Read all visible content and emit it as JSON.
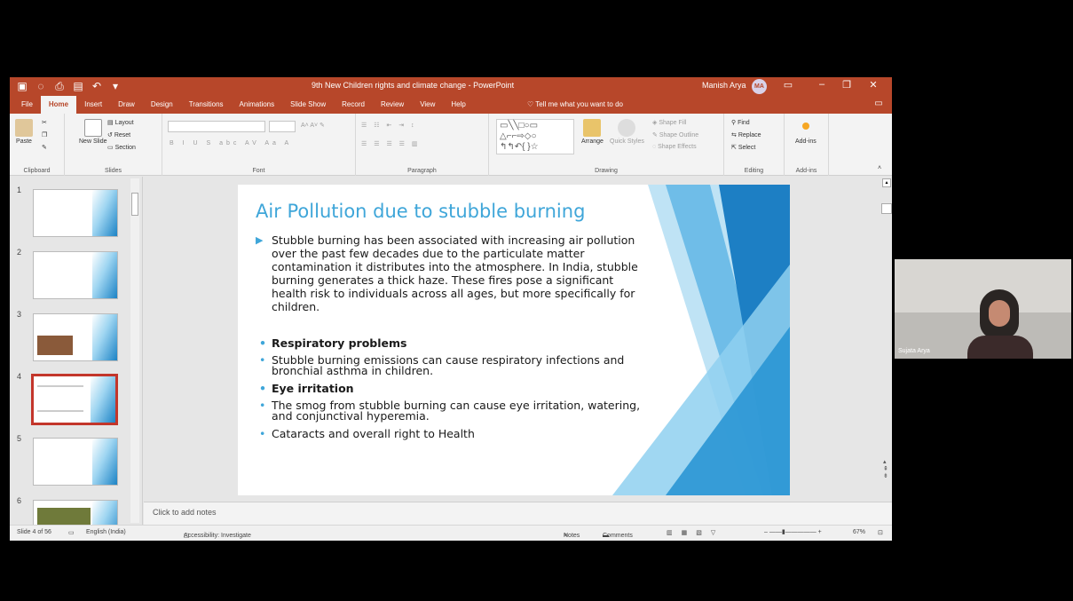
{
  "titlebar": {
    "document_title": "9th New Children rights and climate change - PowerPoint",
    "user_name": "Manish Arya",
    "user_initials": "MA",
    "qat_icons": [
      "save-icon",
      "autosave-icon",
      "print-preview-icon",
      "open-icon",
      "undo-icon",
      "customize-qat-icon"
    ]
  },
  "tabs": [
    "File",
    "Home",
    "Insert",
    "Draw",
    "Design",
    "Transitions",
    "Animations",
    "Slide Show",
    "Record",
    "Review",
    "View",
    "Help"
  ],
  "active_tab": "Home",
  "tell_me": "Tell me what you want to do",
  "ribbon": {
    "clipboard": {
      "paste": "Paste",
      "label": "Clipboard"
    },
    "slides": {
      "new_slide": "New Slide",
      "layout": "Layout",
      "reset": "Reset",
      "section": "Section",
      "label": "Slides"
    },
    "font": {
      "label": "Font"
    },
    "paragraph": {
      "label": "Paragraph"
    },
    "drawing": {
      "arrange": "Arrange",
      "quick_styles": "Quick Styles",
      "shape_fill": "Shape Fill",
      "shape_outline": "Shape Outline",
      "shape_effects": "Shape Effects",
      "label": "Drawing"
    },
    "editing": {
      "find": "Find",
      "replace": "Replace",
      "select": "Select",
      "label": "Editing"
    },
    "addins": {
      "button": "Add-ins",
      "label": "Add-ins"
    }
  },
  "thumbnails": [
    "1",
    "2",
    "3",
    "4",
    "5",
    "6"
  ],
  "selected_slide": "4",
  "slide": {
    "title": "Air Pollution due to stubble burning",
    "lead": "Stubble burning has been associated with increasing air pollution over the past few decades due to the particulate matter contamination it distributes into the atmosphere. In India, stubble burning generates a thick haze. These fires pose a significant health risk to individuals across all ages, but more specifically for children.",
    "bullets": [
      {
        "text": "Respiratory problems",
        "bold": true
      },
      {
        "text": "Stubble burning emissions can cause respiratory infections and bronchial asthma in children.",
        "bold": false
      },
      {
        "text": "Eye irritation",
        "bold": true
      },
      {
        "text": "The smog from stubble burning can cause eye irritation, watering, and conjunctival hyperemia.",
        "bold": false
      },
      {
        "text": "Cataracts and overall right to Health",
        "bold": false
      }
    ]
  },
  "notes_placeholder": "Click to add notes",
  "statusbar": {
    "slide_count": "Slide 4 of 56",
    "language": "English (India)",
    "accessibility": "Accessibility: Investigate",
    "notes": "Notes",
    "comments": "Comments",
    "zoom": "67%"
  },
  "video": {
    "participant": "Sujata Arya"
  },
  "colors": {
    "accent": "#b7472a",
    "slide_title": "#3fa6d9",
    "selected_thumb_border": "#c3362b"
  }
}
